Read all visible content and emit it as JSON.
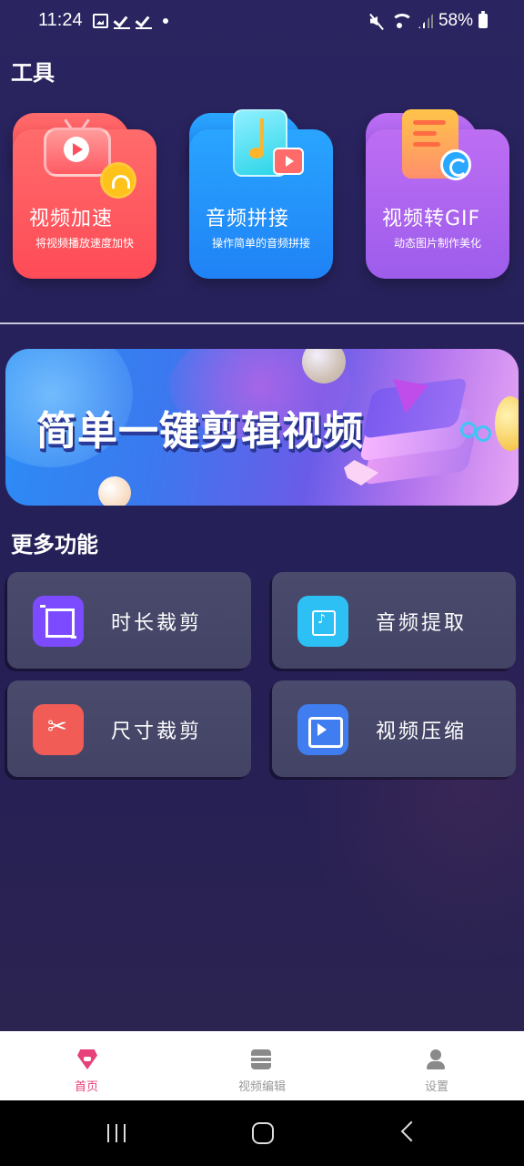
{
  "status_bar": {
    "time": "11:24",
    "battery": "58%"
  },
  "tools": {
    "title": "工具",
    "items": [
      {
        "title": "视频加速",
        "subtitle": "将视频播放速度加快",
        "color": "#fe4b57",
        "icon": "speed-tv-icon"
      },
      {
        "title": "音频拼接",
        "subtitle": "操作简单的音频拼接",
        "color": "#1f82f5",
        "icon": "music-note-icon"
      },
      {
        "title": "视频转GIF",
        "subtitle": "动态图片制作美化",
        "color": "#9d5ceb",
        "icon": "gif-convert-icon"
      }
    ]
  },
  "banner": {
    "text": "简单一键剪辑视频"
  },
  "more": {
    "title": "更多功能",
    "items": [
      {
        "label": "时长裁剪",
        "icon": "crop-icon",
        "color": "#7c4bff"
      },
      {
        "label": "音频提取",
        "icon": "audio-file-icon",
        "color": "#2cc0f5"
      },
      {
        "label": "尺寸裁剪",
        "icon": "scissors-icon",
        "color": "#f15d56"
      },
      {
        "label": "视频压缩",
        "icon": "video-compress-icon",
        "color": "#3f7df0"
      }
    ]
  },
  "bottom_nav": {
    "items": [
      {
        "label": "首页",
        "icon": "home-icon",
        "active": true
      },
      {
        "label": "视频编辑",
        "icon": "film-icon",
        "active": false
      },
      {
        "label": "设置",
        "icon": "user-icon",
        "active": false
      }
    ],
    "active_color": "#e8407a"
  }
}
